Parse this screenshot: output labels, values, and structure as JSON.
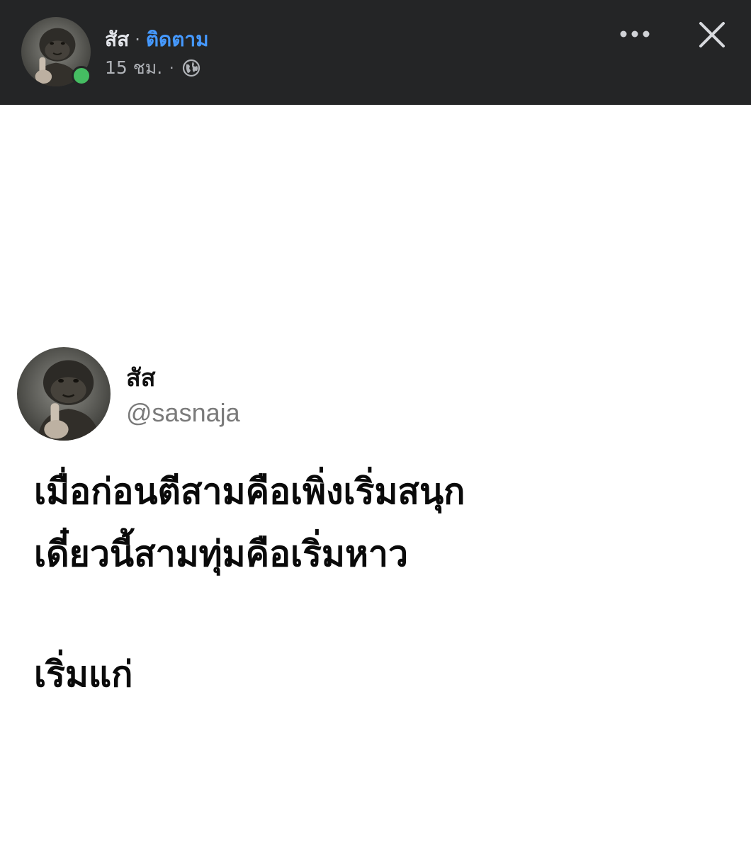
{
  "header": {
    "author_name": "สัส",
    "separator": "·",
    "follow_label": "ติดตาม",
    "time": "15 ชม.",
    "meta_separator": "·",
    "privacy_icon": "globe-icon",
    "more_icon": "more-dots-icon",
    "close_icon": "close-icon",
    "online_status_color": "#45bd62",
    "background_color": "#242526",
    "follow_color": "#4599ff"
  },
  "tweet": {
    "display_name": "สัส",
    "handle": "@sasnaja",
    "lines": [
      "เมื่อก่อนตีสามคือเพิ่งเริ่มสนุก",
      "เดี๋ยวนี้สามทุ่มคือเริ่มหาว",
      "เริ่มแก่"
    ]
  }
}
